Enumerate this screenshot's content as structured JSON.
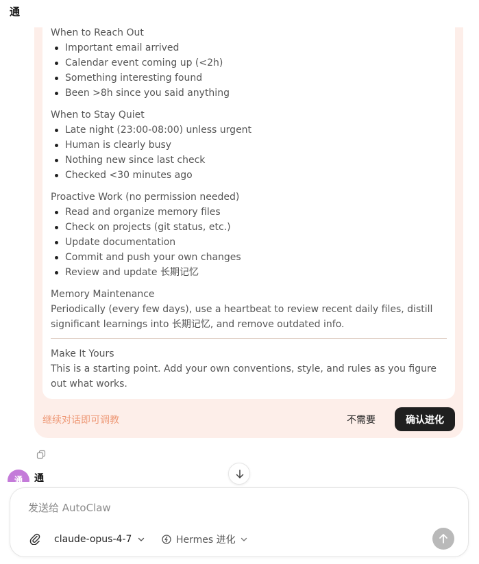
{
  "header": {
    "title": "通"
  },
  "proposal": {
    "sections": [
      {
        "title": "When to Reach Out",
        "items": [
          "Important email arrived",
          "Calendar event coming up (<2h)",
          "Something interesting found",
          "Been >8h since you said anything"
        ]
      },
      {
        "title": "When to Stay Quiet",
        "items": [
          "Late night (23:00-08:00) unless urgent",
          "Human is clearly busy",
          "Nothing new since last check",
          "Checked <30 minutes ago"
        ]
      },
      {
        "title": "Proactive Work (no permission needed)",
        "items": [
          "Read and organize memory files",
          "Check on projects (git status, etc.)",
          "Update documentation",
          "Commit and push your own changes",
          "Review and update 长期记忆"
        ]
      }
    ],
    "memory_title": "Memory Maintenance",
    "memory_text": "Periodically (every few days), use a heartbeat to review recent daily files, distill significant learnings into 长期记忆, and remove outdated info.",
    "own_title": "Make It Yours",
    "own_text": "This is a starting point. Add your own conventions, style, and rules as you figure out what works.",
    "hint": "继续对话即可调教",
    "decline_label": "不需要",
    "confirm_label": "确认进化"
  },
  "message": {
    "sender": "通",
    "avatar_char": "通"
  },
  "composer": {
    "placeholder": "发送给 AutoClaw",
    "model": "claude-opus-4-7",
    "mode": "Hermes 进化"
  },
  "colors": {
    "card_bg": "#fdeee9",
    "hint": "#ee9a78",
    "confirm_bg": "#1f1f1f",
    "avatar": "#c47bd9",
    "send_disabled": "#b9b9b9"
  }
}
